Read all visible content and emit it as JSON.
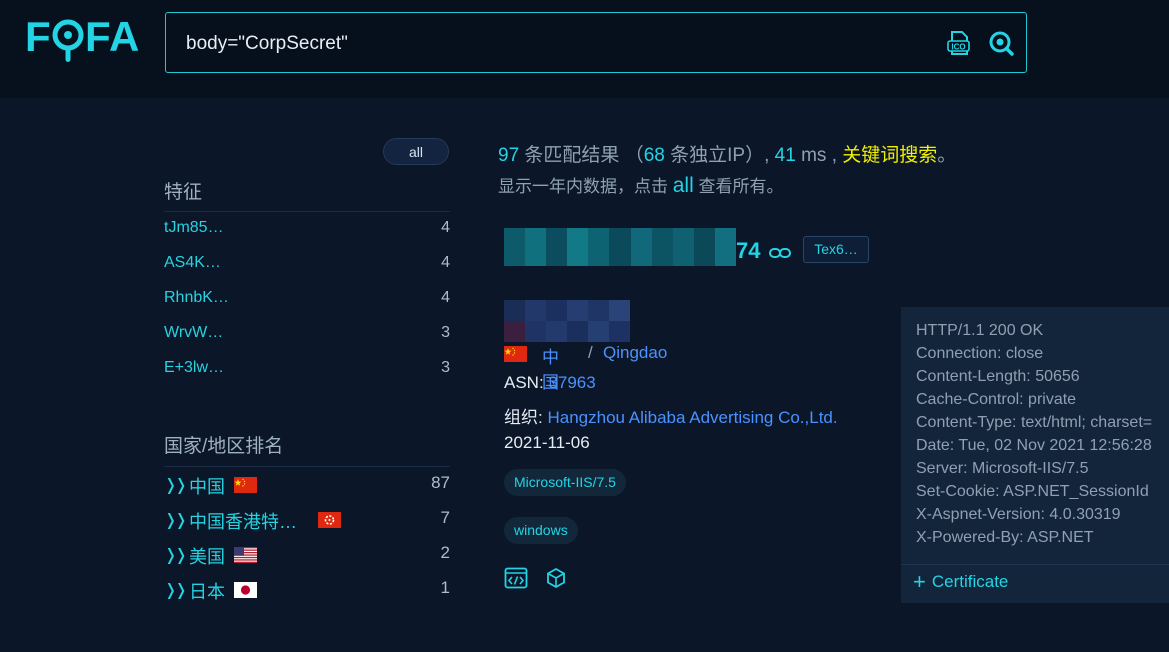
{
  "logo": {
    "text": "FOFA"
  },
  "search": {
    "query": "body=\"CorpSecret\""
  },
  "sidebar": {
    "all_button": "all",
    "features_title": "特征",
    "features": [
      {
        "label": "tJm85…",
        "count": "4"
      },
      {
        "label": "AS4K…",
        "count": "4"
      },
      {
        "label": "RhnbK…",
        "count": "4"
      },
      {
        "label": "WrvW…",
        "count": "3"
      },
      {
        "label": "E+3lw…",
        "count": "3"
      }
    ],
    "countries_title": "国家/地区排名",
    "countries": [
      {
        "name": "中国",
        "count": "87",
        "flag": "cn"
      },
      {
        "name": "中国香港特…",
        "count": "7",
        "flag": "hk"
      },
      {
        "name": "美国",
        "count": "2",
        "flag": "us"
      },
      {
        "name": "日本",
        "count": "1",
        "flag": "jp"
      }
    ]
  },
  "summary": {
    "total": "97",
    "matches_label": "条匹配结果",
    "open_paren": "（",
    "unique_ip": "68",
    "unique_ip_label": "条独立IP）,",
    "time": "41",
    "time_unit": "ms ,",
    "keyword_search": "关键词搜索",
    "end": "。",
    "note_prefix": "显示一年内数据，点击",
    "note_all": "all",
    "note_suffix": "查看所有。"
  },
  "result": {
    "host_tail": "74",
    "tag": "Tex6…",
    "country": "中国",
    "separator": "/",
    "city": "Qingdao",
    "asn_label": "ASN:",
    "asn_value": "37963",
    "org_label": "组织:",
    "org_value": "Hangzhou Alibaba Advertising Co.,Ltd.",
    "date": "2021-11-06",
    "chips": [
      "Microsoft-IIS/7.5",
      "windows"
    ]
  },
  "headers_panel": {
    "lines": [
      "HTTP/1.1 200 OK",
      "Connection: close",
      "Content-Length: 50656",
      "Cache-Control: private",
      "Content-Type: text/html; charset=",
      "Date: Tue, 02 Nov 2021 12:56:28",
      "Server: Microsoft-IIS/7.5",
      "Set-Cookie: ASP.NET_SessionId",
      "X-Aspnet-Version: 4.0.30319",
      "X-Powered-By: ASP.NET"
    ],
    "certificate_label": "Certificate"
  },
  "colors": {
    "accent": "#22d4e4",
    "link": "#4a92ff",
    "keyword": "#f0f000",
    "background": "#0b1629"
  }
}
